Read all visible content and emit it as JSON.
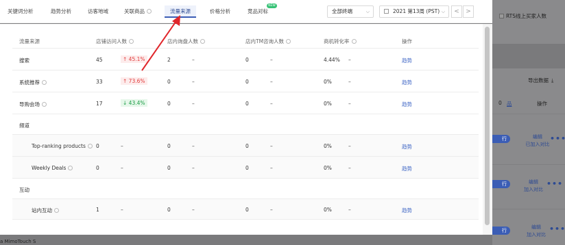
{
  "tabs": [
    {
      "label": "关键词分析",
      "active": false
    },
    {
      "label": "趋势分析",
      "active": false
    },
    {
      "label": "访客地域",
      "active": false
    },
    {
      "label": "关联商品",
      "active": false
    },
    {
      "label": "流量来源",
      "active": true
    },
    {
      "label": "价格分析",
      "active": false
    },
    {
      "label": "竞品对标",
      "active": false
    }
  ],
  "new_badge": "NEW",
  "filter": {
    "terminal": "全部终端",
    "date_range": "2021 第13周 (PST)"
  },
  "nav": {
    "prev": "<",
    "next": ">"
  },
  "table": {
    "headers": {
      "source": "流量来源",
      "store_visitors": "店铺访问人数",
      "store_inquirers": "店内询盘人数",
      "tm_inquirers": "店内TM咨询人数",
      "conversion": "商机转化率",
      "action": "操作"
    },
    "rows": [
      {
        "name": "搜索",
        "visitors": "45",
        "change": "↑ 45.1%",
        "dir": "up",
        "inq": "2",
        "inq_chg": "–",
        "tm": "0",
        "tm_chg": "–",
        "conv": "4.44%",
        "conv_chg": "–",
        "action": "趋势"
      },
      {
        "name": "系统推荐",
        "visitors": "33",
        "change": "↑ 73.6%",
        "dir": "up",
        "inq": "0",
        "inq_chg": "–",
        "tm": "0",
        "tm_chg": "–",
        "conv": "0%",
        "conv_chg": "–",
        "action": "趋势"
      },
      {
        "name": "导购会场",
        "visitors": "17",
        "change": "↓ 43.4%",
        "dir": "down",
        "inq": "0",
        "inq_chg": "–",
        "tm": "0",
        "tm_chg": "–",
        "conv": "0%",
        "conv_chg": "–",
        "action": "趋势"
      }
    ],
    "group_channels": "频道",
    "channel_rows": [
      {
        "name": "Top-ranking products",
        "visitors": "0",
        "change": "–",
        "inq": "0",
        "inq_chg": "–",
        "tm": "0",
        "tm_chg": "–",
        "conv": "0%",
        "conv_chg": "–",
        "action": "趋势"
      },
      {
        "name": "Weekly Deals",
        "visitors": "0",
        "change": "–",
        "inq": "0",
        "inq_chg": "–",
        "tm": "0",
        "tm_chg": "–",
        "conv": "0%",
        "conv_chg": "–",
        "action": "趋势"
      }
    ],
    "group_interaction": "互动",
    "interaction_rows": [
      {
        "name": "站内互动",
        "visitors": "1",
        "change": "–",
        "inq": "0",
        "inq_chg": "–",
        "tm": "0",
        "tm_chg": "–",
        "conv": "0%",
        "conv_chg": "–",
        "action": "趋势"
      }
    ]
  },
  "background": {
    "rts_label": "RTS线上买家人数",
    "export_label": "导出数据",
    "col_zero": "0",
    "col_action": "操作",
    "rows": [
      {
        "edit": "编辑",
        "compare": "已加入对比"
      },
      {
        "edit": "编辑",
        "compare": "加入对比"
      },
      {
        "edit": "编辑",
        "compare": "加入对比"
      }
    ],
    "pill": "行",
    "bottom_text": "a MimoTouch S"
  }
}
